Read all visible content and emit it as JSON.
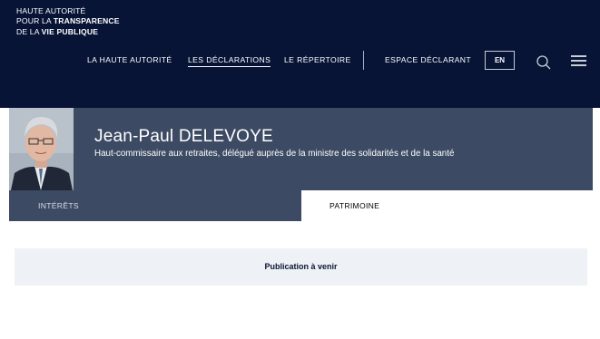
{
  "logo": {
    "line1": "HAUTE AUTORITÉ",
    "line2_pre": "POUR LA ",
    "line2_bold": "TRANSPARENCE",
    "line3_pre": "DE LA ",
    "line3_bold": "VIE PUBLIQUE"
  },
  "nav": {
    "items": [
      {
        "label": "LA HAUTE AUTORITÉ"
      },
      {
        "label": "LES DÉCLARATIONS",
        "active": true
      },
      {
        "label": "LE RÉPERTOIRE"
      },
      {
        "label": "ESPACE DÉCLARANT"
      }
    ],
    "lang": "EN",
    "icons": [
      "search-icon",
      "menu-icon"
    ]
  },
  "profile": {
    "name": "Jean-Paul DELEVOYE",
    "role": "Haut-commissaire aux retraites, délégué auprès de la ministre des solidarités et de la santé"
  },
  "tabs": [
    {
      "label": "INTÉRÊTS",
      "active": false
    },
    {
      "label": "PATRIMOINE",
      "active": true
    }
  ],
  "main": {
    "publication_text": "Publication à venir"
  },
  "colors": {
    "header_bg": "#071436",
    "banner_bg": "#3c4a63",
    "panel_bg": "#eef2f6",
    "text_light": "#ffffff",
    "text_dark": "#0b1430"
  }
}
